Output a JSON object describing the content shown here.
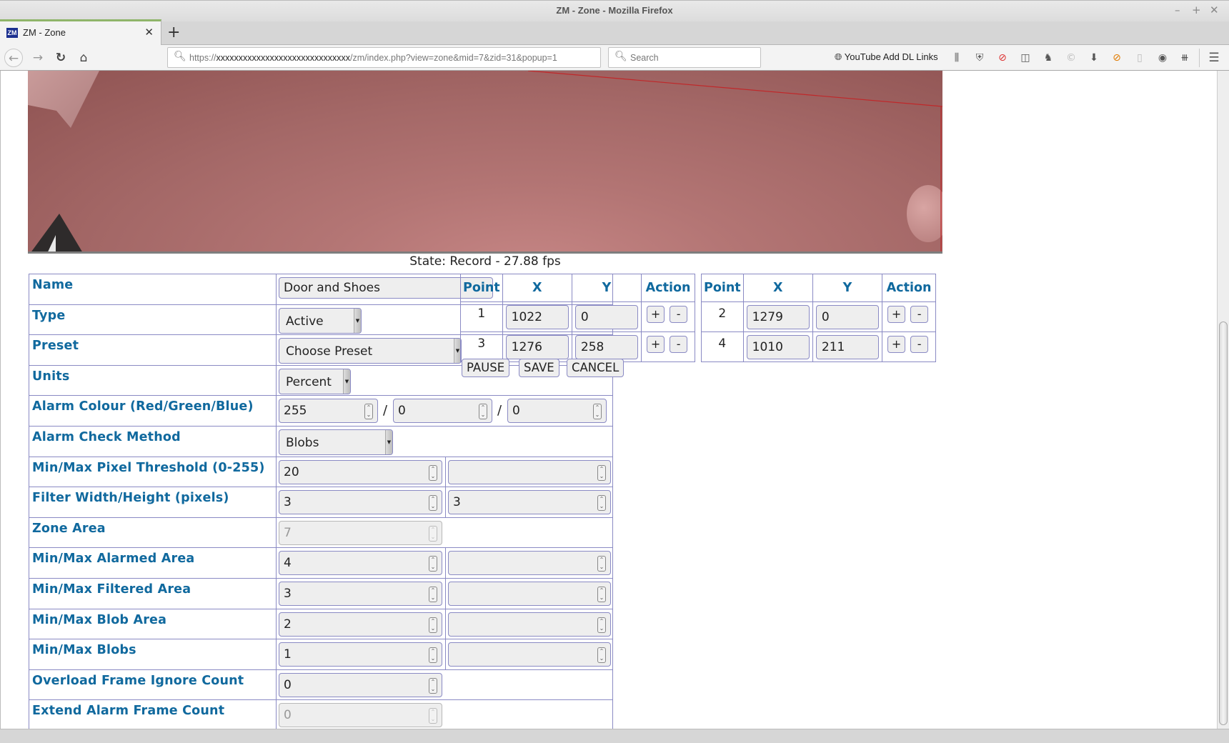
{
  "window": {
    "title": "ZM - Zone - Mozilla Firefox",
    "controls": [
      "minimize",
      "maximize",
      "close"
    ]
  },
  "tabs": [
    {
      "label": "ZM - Zone",
      "favicon": "ZM",
      "active": true
    }
  ],
  "navbar": {
    "url_prefix": "https://",
    "url_host": "xxxxxxxxxxxxxxxxxxxxxxxxxxxxxx",
    "url_path": "/zm/index.php?view=zone&mid=7&zid=31&popup=1",
    "search_placeholder": "Search",
    "extension_label": "YouTube Add DL Links"
  },
  "page": {
    "state_text": "State: Record - 27.88 fps",
    "form": {
      "name_label": "Name",
      "name_value": "Door and Shoes",
      "type_label": "Type",
      "type_value": "Active",
      "preset_label": "Preset",
      "preset_value": "Choose Preset",
      "units_label": "Units",
      "units_value": "Percent",
      "alarm_colour_label": "Alarm Colour (Red/Green/Blue)",
      "alarm_colour": {
        "red": "255",
        "green": "0",
        "blue": "0"
      },
      "check_method_label": "Alarm Check Method",
      "check_method_value": "Blobs",
      "pixel_threshold_label": "Min/Max Pixel Threshold (0-255)",
      "pixel_threshold": {
        "min": "20",
        "max": ""
      },
      "filter_label": "Filter Width/Height (pixels)",
      "filter": {
        "width": "3",
        "height": "3"
      },
      "zone_area_label": "Zone Area",
      "zone_area_value": "7",
      "alarmed_area_label": "Min/Max Alarmed Area",
      "alarmed_area": {
        "min": "4",
        "max": ""
      },
      "filtered_area_label": "Min/Max Filtered Area",
      "filtered_area": {
        "min": "3",
        "max": ""
      },
      "blob_area_label": "Min/Max Blob Area",
      "blob_area": {
        "min": "2",
        "max": ""
      },
      "blobs_label": "Min/Max Blobs",
      "blobs": {
        "min": "1",
        "max": ""
      },
      "overload_label": "Overload Frame Ignore Count",
      "overload_value": "0",
      "extend_label": "Extend Alarm Frame Count",
      "extend_value": "0"
    },
    "points": {
      "headers": {
        "point": "Point",
        "x": "X",
        "y": "Y",
        "action": "Action"
      },
      "left": [
        {
          "n": "1",
          "x": "1022",
          "y": "0"
        },
        {
          "n": "3",
          "x": "1276",
          "y": "258"
        }
      ],
      "right": [
        {
          "n": "2",
          "x": "1279",
          "y": "0"
        },
        {
          "n": "4",
          "x": "1010",
          "y": "211"
        }
      ],
      "add_label": "+",
      "remove_label": "-"
    },
    "buttons": {
      "pause": "PAUSE",
      "save": "SAVE",
      "cancel": "CANCEL"
    }
  },
  "colors": {
    "label_blue": "#10699e",
    "border": "#8a8ac4",
    "alarm_overlay": "#a46867"
  }
}
